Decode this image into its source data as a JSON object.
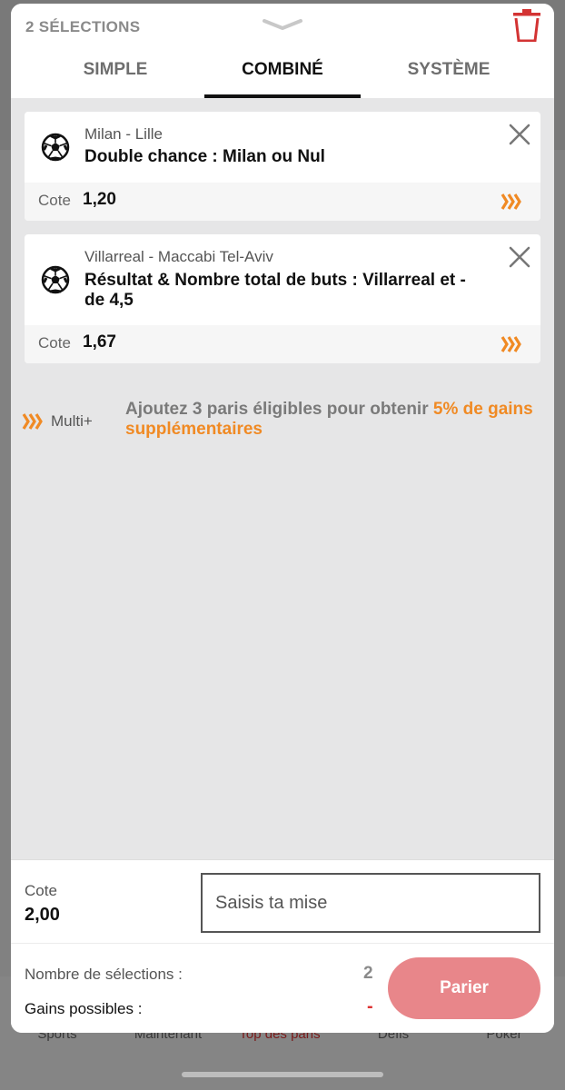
{
  "header": {
    "selection_count": "2 SÉLECTIONS",
    "tabs": [
      {
        "label": "SIMPLE",
        "active": false
      },
      {
        "label": "COMBINÉ",
        "active": true
      },
      {
        "label": "SYSTÈME",
        "active": false
      }
    ]
  },
  "bets": [
    {
      "icon": "soccer-ball-icon",
      "match": "Milan - Lille",
      "market": "Double chance : Milan ou Nul",
      "cote_label": "Cote",
      "cote": "1,20"
    },
    {
      "icon": "soccer-ball-icon",
      "match": "Villarreal - Maccabi Tel-Aviv",
      "market": "Résultat & Nombre total de buts : Villarreal et - de 4,5",
      "cote_label": "Cote",
      "cote": "1,67"
    }
  ],
  "multi": {
    "label": "Multi+",
    "promo_text": "Ajoutez 3 paris éligibles pour obtenir ",
    "promo_highlight": "5% de gains supplémentaires"
  },
  "stake": {
    "cote_label": "Cote",
    "cote_value": "2,00",
    "input_placeholder": "Saisis ta mise",
    "input_value": ""
  },
  "summary": {
    "nb_selections_label": "Nombre de sélections :",
    "nb_selections_value": "2",
    "gains_label": "Gains possibles :",
    "gains_value": "-",
    "submit_label": "Parier"
  },
  "background_nav": [
    "Sports",
    "Maintenant",
    "Top des paris",
    "Défis",
    "Poker"
  ],
  "colors": {
    "accent_orange": "#f08a24",
    "danger_red": "#d33333",
    "button_disabled_pink": "#e8868a"
  }
}
